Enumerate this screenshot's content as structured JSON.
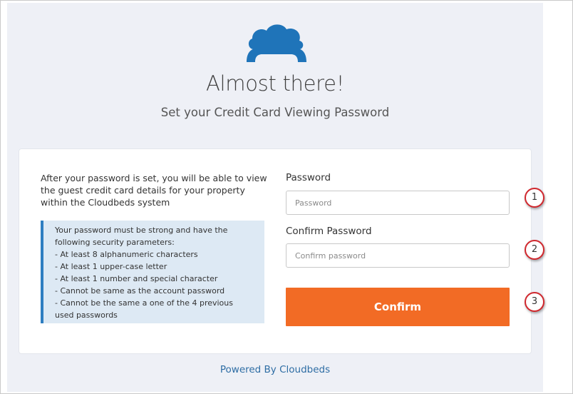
{
  "header": {
    "title": "Almost there!",
    "subtitle": "Set your Credit Card Viewing Password"
  },
  "logo": {
    "icon": "cloudbeds-logo-icon",
    "color": "#1f74b9"
  },
  "info": {
    "intro": "After your password is set, you will be able to view the guest credit card details for your property within the Cloudbeds system",
    "note_lines": [
      "Your password must be strong and have the",
      "following security parameters:",
      "- At least 8 alphanumeric characters",
      "- At least 1 upper-case letter",
      "- At least 1 number and special character",
      "- Cannot be same as the account password",
      "- Cannot be the same a one of the 4 previous",
      "used passwords"
    ]
  },
  "form": {
    "password_label": "Password",
    "password_placeholder": "Password",
    "confirm_label": "Confirm Password",
    "confirm_placeholder": "Confirm password",
    "submit_label": "Confirm"
  },
  "callouts": [
    "1",
    "2",
    "3"
  ],
  "footer": {
    "link": "Powered By Cloudbeds"
  },
  "colors": {
    "accent": "#f26b25",
    "brand": "#1f74b9",
    "callout_border": "#d0282e",
    "note_bar": "#2e7ec1"
  }
}
